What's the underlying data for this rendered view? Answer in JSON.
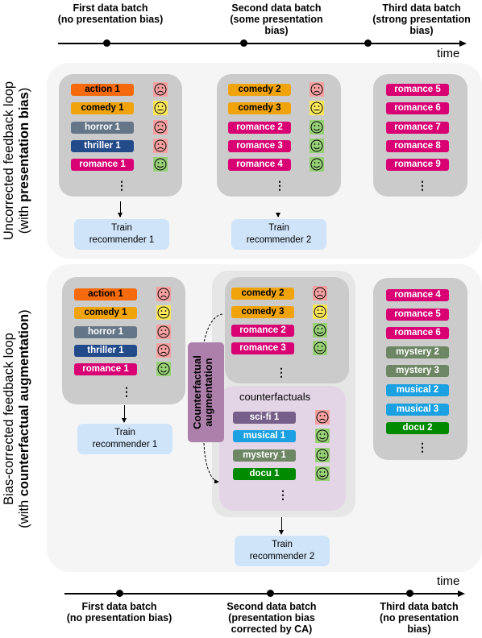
{
  "colors": {
    "action": "#f46a0c",
    "comedy": "#f0a30a",
    "horror": "#647687",
    "thriller": "#234b8a",
    "romance": "#d80073",
    "scifi": "#76608a",
    "musical": "#1ba1e2",
    "mystery": "#6d8764",
    "docu": "#008a00",
    "sad": "#f8a1a1",
    "neutral": "#fbe75a",
    "happy": "#97d077",
    "train": "#cfe4f9",
    "ca": "#ad7fab",
    "counterfactuals_bg": "#e3d5e6"
  },
  "top_timeline": {
    "time_label": "time",
    "batches": [
      {
        "line1": "First data batch",
        "line2": "(no presentation bias)",
        "line3": ""
      },
      {
        "line1": "Second data batch",
        "line2": "(some presentation",
        "line3": "bias)"
      },
      {
        "line1": "Third data batch",
        "line2": "(strong presentation",
        "line3": "bias)"
      }
    ]
  },
  "bottom_timeline": {
    "time_label": "time",
    "batches": [
      {
        "line1": "First data batch",
        "line2": "(no presentation bias)",
        "line3": ""
      },
      {
        "line1": "Second data batch",
        "line2": "(presentation bias",
        "line3": "corrected by CA)"
      },
      {
        "line1": "Third data batch",
        "line2": "(no presentation",
        "line3": "bias)"
      }
    ]
  },
  "uncorrected": {
    "label_line1": "Uncorrected feedback loop",
    "label_line2_prefix": "(with ",
    "label_line2_bold": "presentation bias",
    "label_line2_suffix": ")",
    "batch1": [
      {
        "label": "action 1",
        "genre": "action",
        "feedback": "sad"
      },
      {
        "label": "comedy 1",
        "genre": "comedy",
        "feedback": "neutral"
      },
      {
        "label": "horror 1",
        "genre": "horror",
        "feedback": "sad"
      },
      {
        "label": "thriller 1",
        "genre": "thriller",
        "feedback": "sad"
      },
      {
        "label": "romance 1",
        "genre": "romance",
        "feedback": "happy"
      }
    ],
    "batch2": [
      {
        "label": "comedy 2",
        "genre": "comedy",
        "feedback": "sad"
      },
      {
        "label": "comedy 3",
        "genre": "comedy",
        "feedback": "neutral"
      },
      {
        "label": "romance 2",
        "genre": "romance",
        "feedback": "happy"
      },
      {
        "label": "romance 3",
        "genre": "romance",
        "feedback": "happy"
      },
      {
        "label": "romance 4",
        "genre": "romance",
        "feedback": "happy"
      }
    ],
    "batch3": [
      {
        "label": "romance 5",
        "genre": "romance"
      },
      {
        "label": "romance 6",
        "genre": "romance"
      },
      {
        "label": "romance 7",
        "genre": "romance"
      },
      {
        "label": "romance 8",
        "genre": "romance"
      },
      {
        "label": "romance 9",
        "genre": "romance"
      }
    ],
    "train1": {
      "line1": "Train",
      "line2": "recommender 1"
    },
    "train2": {
      "line1": "Train",
      "line2": "recommender 2"
    }
  },
  "corrected": {
    "label_line1": "Bias-corrected feedback loop",
    "label_line2_prefix": "(with ",
    "label_line2_bold": "counterfactual augmentation",
    "label_line2_suffix": ")",
    "batch1": [
      {
        "label": "action 1",
        "genre": "action",
        "feedback": "sad"
      },
      {
        "label": "comedy 1",
        "genre": "comedy",
        "feedback": "neutral"
      },
      {
        "label": "horror 1",
        "genre": "horror",
        "feedback": "sad"
      },
      {
        "label": "thriller 1",
        "genre": "thriller",
        "feedback": "sad"
      },
      {
        "label": "romance 1",
        "genre": "romance",
        "feedback": "happy"
      }
    ],
    "batch2": [
      {
        "label": "comedy 2",
        "genre": "comedy",
        "feedback": "sad"
      },
      {
        "label": "comedy 3",
        "genre": "comedy",
        "feedback": "neutral"
      },
      {
        "label": "romance 2",
        "genre": "romance",
        "feedback": "happy"
      },
      {
        "label": "romance 3",
        "genre": "romance",
        "feedback": "happy"
      }
    ],
    "counterfactuals_title": "counterfactuals",
    "counterfactuals": [
      {
        "label": "sci-fi 1",
        "genre": "scifi",
        "feedback": "sad"
      },
      {
        "label": "musical 1",
        "genre": "musical",
        "feedback": "happy"
      },
      {
        "label": "mystery 1",
        "genre": "mystery",
        "feedback": "happy"
      },
      {
        "label": "docu 1",
        "genre": "docu",
        "feedback": "happy"
      }
    ],
    "ca_label_line1": "Counterfactual",
    "ca_label_line2": "augmentation",
    "batch3": [
      {
        "label": "romance 4",
        "genre": "romance"
      },
      {
        "label": "romance 5",
        "genre": "romance"
      },
      {
        "label": "romance 6",
        "genre": "romance"
      },
      {
        "label": "mystery 2",
        "genre": "mystery"
      },
      {
        "label": "mystery 3",
        "genre": "mystery"
      },
      {
        "label": "musical 2",
        "genre": "musical"
      },
      {
        "label": "musical 3",
        "genre": "musical"
      },
      {
        "label": "docu 2",
        "genre": "docu"
      }
    ],
    "train1": {
      "line1": "Train",
      "line2": "recommender 1"
    },
    "train2": {
      "line1": "Train",
      "line2": "recommender 2"
    }
  },
  "ellipsis": "⋮"
}
